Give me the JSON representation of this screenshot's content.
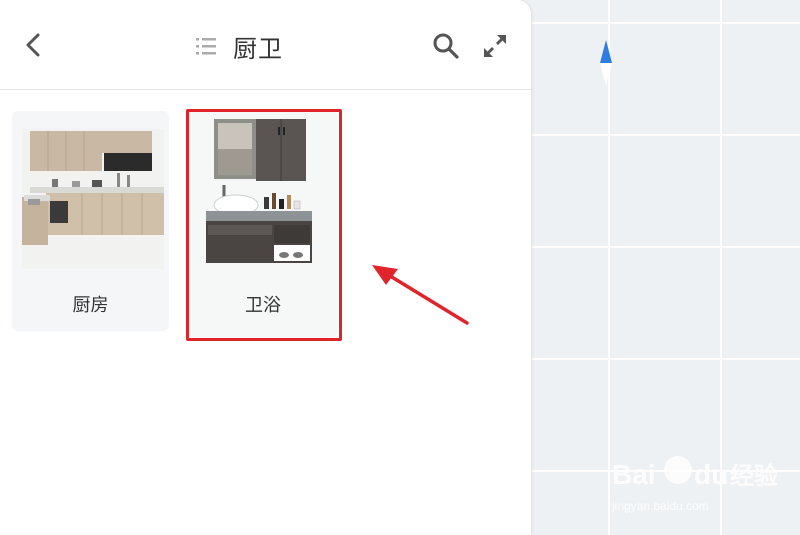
{
  "panel": {
    "title": "厨卫",
    "icons": {
      "back": "chevron-left-icon",
      "list": "list-icon",
      "search": "search-icon",
      "expand": "expand-icon"
    }
  },
  "categories": [
    {
      "label": "厨房",
      "selected": false
    },
    {
      "label": "卫浴",
      "selected": true
    }
  ],
  "colors": {
    "highlight": "#e0242b",
    "compass_accent": "#2f7de1",
    "canvas_bg": "#eef1f4"
  },
  "watermark": {
    "brand": "Baidu 经验",
    "url": "jingyan.baidu.com"
  }
}
